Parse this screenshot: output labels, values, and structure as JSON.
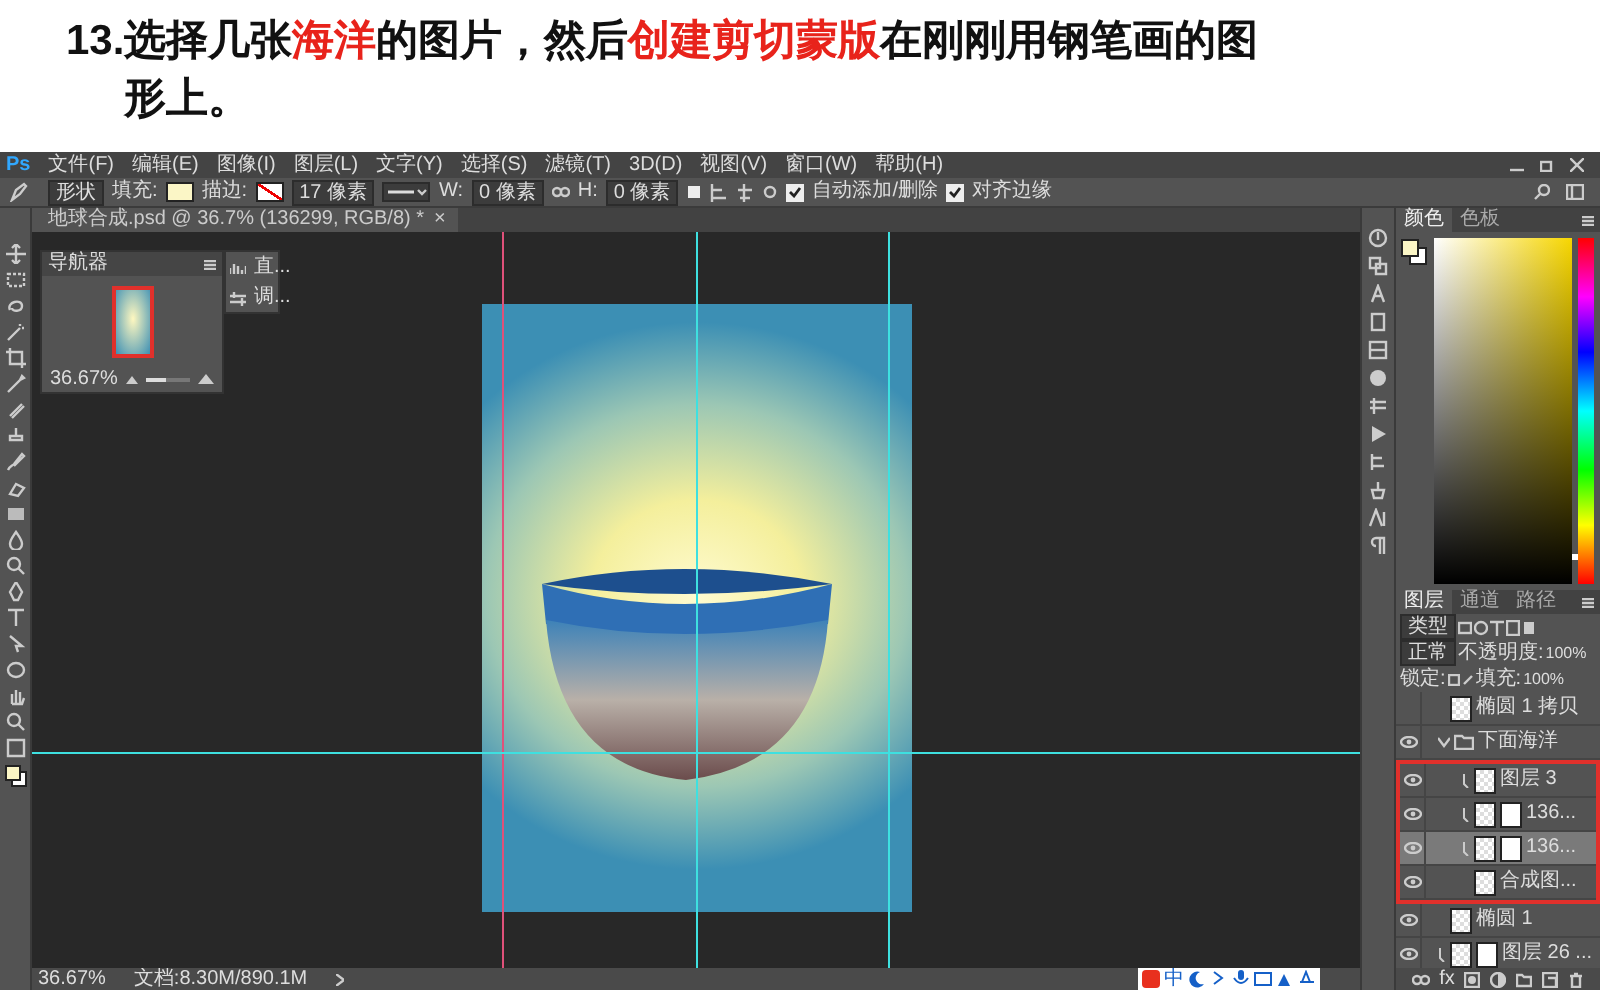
{
  "title": {
    "lines": [
      {
        "segments": [
          {
            "text": "13.选择几张",
            "highlight": false
          },
          {
            "text": "海洋",
            "highlight": true
          },
          {
            "text": "的图片，然后",
            "highlight": false
          },
          {
            "text": "创建剪切蒙版",
            "highlight": true
          },
          {
            "text": "在刚刚用钢笔画的图",
            "highlight": false
          }
        ]
      },
      {
        "segments": [
          {
            "text": "形上。",
            "highlight": false
          }
        ]
      }
    ]
  },
  "app_logo": "Ps",
  "menu": [
    "文件(F)",
    "编辑(E)",
    "图像(I)",
    "图层(L)",
    "文字(Y)",
    "选择(S)",
    "滤镜(T)",
    "3D(D)",
    "视图(V)",
    "窗口(W)",
    "帮助(H)"
  ],
  "options_bar": {
    "mode": "形状",
    "fill_label": "填充:",
    "stroke_label": "描边:",
    "stroke_width": "17 像素",
    "w_label": "W:",
    "w_value": "0 像素",
    "h_label": "H:",
    "h_value": "0 像素",
    "auto_add_delete": {
      "label": "自动添加/删除",
      "checked": true
    },
    "align_edges": {
      "label": "对齐边缘",
      "checked": true
    }
  },
  "document_tab": {
    "title": "地球合成.psd @ 36.7% (136299, RGB/8) *",
    "close": "×"
  },
  "navigator": {
    "tab": "导航器",
    "zoom": "36.67%",
    "zoom_slider": {
      "level": 0.45
    }
  },
  "mini_panel": {
    "items": [
      "直...",
      "调..."
    ]
  },
  "status_bar": {
    "zoom": "36.67%",
    "document": "文档:8.30M/890.1M",
    "ime": "中"
  },
  "color_panel": {
    "hue_slider": {
      "level": 0.07
    },
    "tabs": [
      {
        "label": "颜色",
        "selected": true
      },
      {
        "label": "色板",
        "selected": false
      }
    ]
  },
  "layers_panel": {
    "tabs": [
      {
        "label": "图层",
        "selected": true
      },
      {
        "label": "通道",
        "selected": false
      },
      {
        "label": "路径",
        "selected": false
      }
    ],
    "filter": "类型",
    "blend_mode": "正常",
    "opacity_label": "不透明度:",
    "opacity": "100%",
    "lock_label": "锁定:",
    "fill_label": "填充:",
    "fill": "100%",
    "footer_fx": "fx",
    "layers": [
      {
        "name": "椭圆 1 拷贝",
        "kind": "layer",
        "visible": false,
        "selected": false,
        "clipped": false,
        "mask": false
      },
      {
        "name": "下面海洋",
        "kind": "group",
        "visible": true,
        "selected": false,
        "expanded": true,
        "outlined": true,
        "children": [
          {
            "name": "图层 3",
            "kind": "layer",
            "visible": true,
            "selected": false,
            "clipped": true,
            "mask": false
          },
          {
            "name": "136...",
            "kind": "layer",
            "visible": true,
            "selected": false,
            "clipped": true,
            "mask": true
          },
          {
            "name": "136...",
            "kind": "layer",
            "visible": true,
            "selected": true,
            "clipped": true,
            "mask": true
          },
          {
            "name": "合成图...",
            "kind": "layer",
            "visible": true,
            "selected": false,
            "clipped": false,
            "mask": false
          }
        ]
      },
      {
        "name": "椭圆 1",
        "kind": "layer",
        "visible": true,
        "selected": false,
        "clipped": false,
        "mask": false
      },
      {
        "name": "图层 26 ...",
        "kind": "layer",
        "visible": true,
        "selected": false,
        "clipped": true,
        "mask": true
      }
    ]
  }
}
